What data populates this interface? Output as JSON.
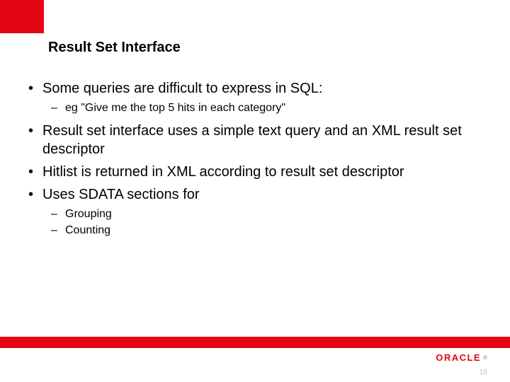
{
  "title": "Result Set Interface",
  "bullets": {
    "b1": "Some queries are difficult to express in SQL:",
    "b1a": "eg \"Give me the top 5 hits in each category\"",
    "b2": "Result set interface uses a simple text query and an XML result set descriptor",
    "b3": "Hitlist is returned in XML according to result set descriptor",
    "b4": "Uses SDATA sections for",
    "b4a": "Grouping",
    "b4b": "Counting"
  },
  "logo_text": "ORACLE",
  "reg_mark": "®",
  "page_number": "18"
}
